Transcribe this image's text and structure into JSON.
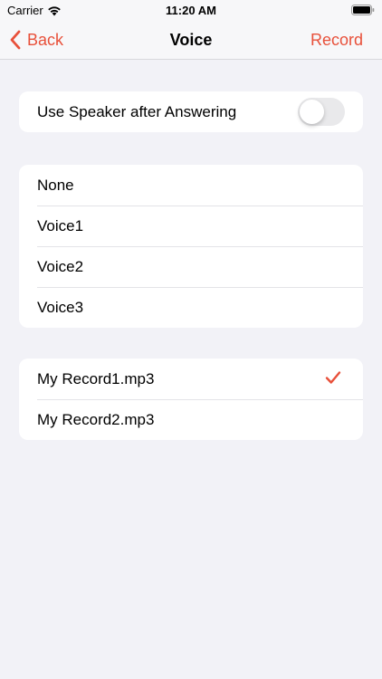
{
  "status_bar": {
    "carrier": "Carrier",
    "time": "11:20 AM"
  },
  "nav": {
    "back_label": "Back",
    "title": "Voice",
    "action_label": "Record"
  },
  "speaker_setting": {
    "label": "Use Speaker after Answering",
    "enabled": false
  },
  "voices": [
    {
      "label": "None"
    },
    {
      "label": "Voice1"
    },
    {
      "label": "Voice2"
    },
    {
      "label": "Voice3"
    }
  ],
  "records": [
    {
      "label": "My Record1.mp3",
      "selected": true
    },
    {
      "label": "My Record2.mp3",
      "selected": false
    }
  ],
  "colors": {
    "accent": "#e8503a",
    "background": "#f2f2f7"
  }
}
